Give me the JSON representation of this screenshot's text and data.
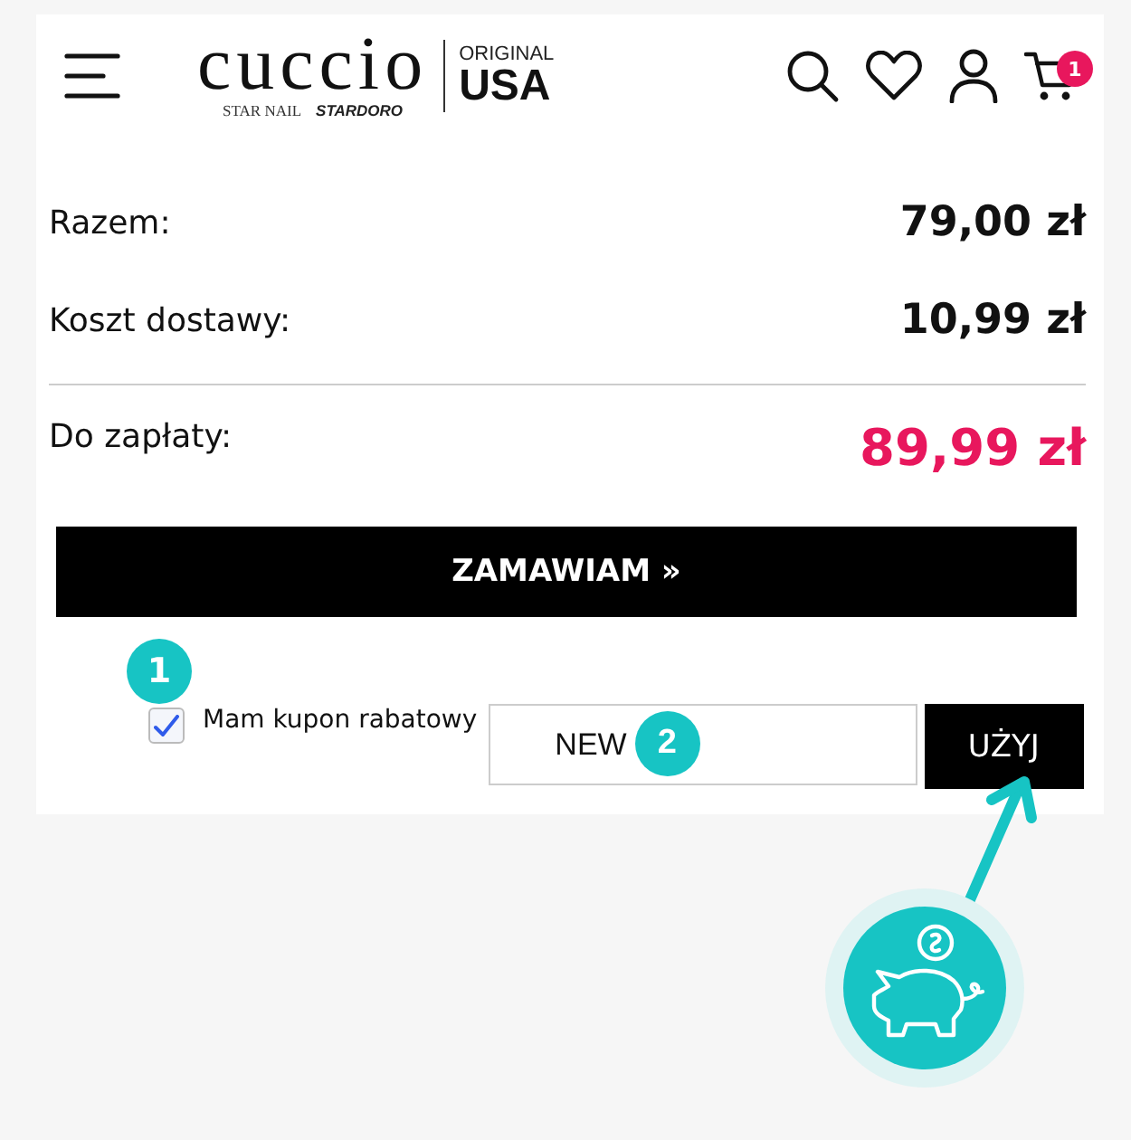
{
  "header": {
    "logo": {
      "brand": "cuccio",
      "sub_brands": [
        "STAR NAIL",
        "STARDORO"
      ],
      "tag_top": "ORIGINAL",
      "tag_main": "USA"
    },
    "cart_count": "1"
  },
  "summary": [
    {
      "kind": "normal",
      "label": "Razem:",
      "value": "79,00 zł"
    },
    {
      "kind": "normal",
      "label": "Koszt dostawy:",
      "value": "10,99 zł"
    },
    {
      "kind": "total",
      "label": "Do zapłaty:",
      "value": "89,99 zł"
    }
  ],
  "order_button": "ZAMAWIAM »",
  "coupon": {
    "checked": true,
    "label": "Mam kupon rabatowy",
    "value": "NEW",
    "button": "UŻYJ"
  },
  "annotations": [
    "1",
    "2"
  ]
}
